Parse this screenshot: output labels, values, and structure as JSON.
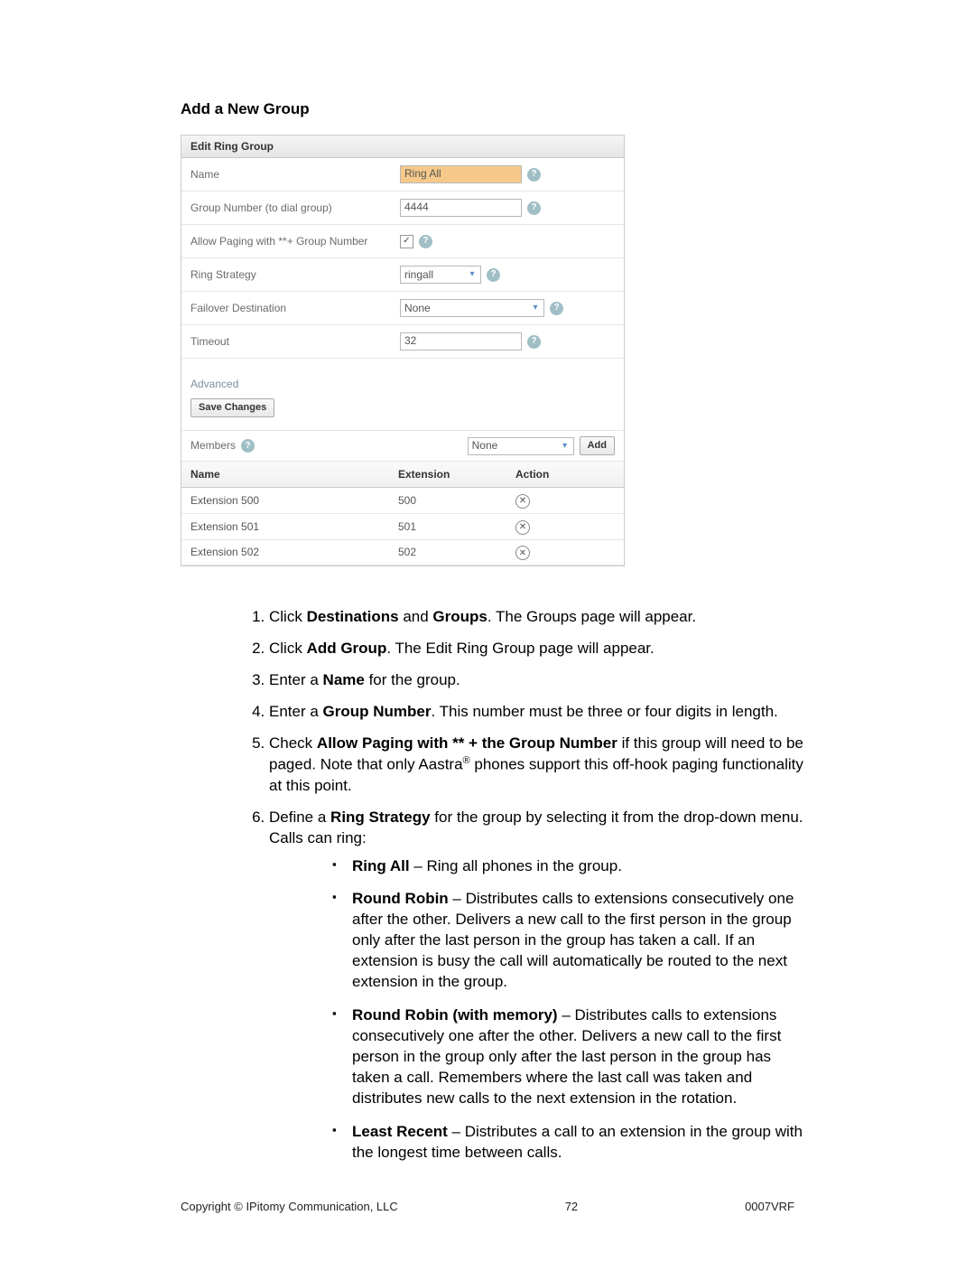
{
  "title": "Add a New Group",
  "panel": {
    "header": "Edit Ring Group",
    "rows": {
      "name_label": "Name",
      "name_value": "Ring All",
      "group_number_label": "Group Number (to dial group)",
      "group_number_value": "4444",
      "allow_paging_label": "Allow Paging with **+ Group Number",
      "allow_paging_checked": true,
      "ring_strategy_label": "Ring Strategy",
      "ring_strategy_value": "ringall",
      "failover_label": "Failover Destination",
      "failover_value": "None",
      "timeout_label": "Timeout",
      "timeout_value": "32"
    },
    "advanced_label": "Advanced",
    "save_button": "Save Changes",
    "members_label": "Members",
    "members_select_value": "None",
    "members_add_button": "Add",
    "table": {
      "headers": {
        "name": "Name",
        "ext": "Extension",
        "action": "Action"
      },
      "rows": [
        {
          "name": "Extension 500",
          "ext": "500"
        },
        {
          "name": "Extension 501",
          "ext": "501"
        },
        {
          "name": "Extension 502",
          "ext": "502"
        }
      ]
    }
  },
  "steps": {
    "s1a": "Click ",
    "s1b": "Destinations",
    "s1c": " and ",
    "s1d": "Groups",
    "s1e": ". The Groups page will appear.",
    "s2a": "Click ",
    "s2b": "Add Group",
    "s2c": ". The Edit Ring Group page will appear.",
    "s3a": "Enter a ",
    "s3b": "Name",
    "s3c": " for the group.",
    "s4a": "Enter a ",
    "s4b": "Group Number",
    "s4c": ". This number must be three or four digits in length.",
    "s5a": "Check ",
    "s5b": "Allow Paging with ** + the Group Number",
    "s5c": " if this group will need to be paged. Note that only Aastra",
    "s5r": "®",
    "s5d": " phones support this off-hook paging functionality at this point.",
    "s6a": "Define a ",
    "s6b": "Ring Strategy",
    "s6c": " for the group by selecting it from the drop-down menu. Calls can ring:"
  },
  "bullets": {
    "b1t": "Ring All",
    "b1r": " – Ring all phones in the group.",
    "b2t": "Round Robin",
    "b2r": " – Distributes calls to extensions consecutively one after the other. Delivers a new call to the first person in the group only after the last person in the group has taken a call. If an extension is busy the call will automatically be routed to the next extension in the group.",
    "b3t": "Round Robin (with memory)",
    "b3r": " – Distributes calls to extensions consecutively one after the other. Delivers a new call to the first person in the group only after the last person in the group has taken a call. Remembers where the last call was taken and distributes new calls to the next extension in the rotation.",
    "b4t": "Least Recent",
    "b4r": " – Distributes a call to an extension in the group with the longest time between calls."
  },
  "footer": {
    "left": "Copyright © IPitomy Communication, LLC",
    "center": "72",
    "right": "0007VRF"
  }
}
